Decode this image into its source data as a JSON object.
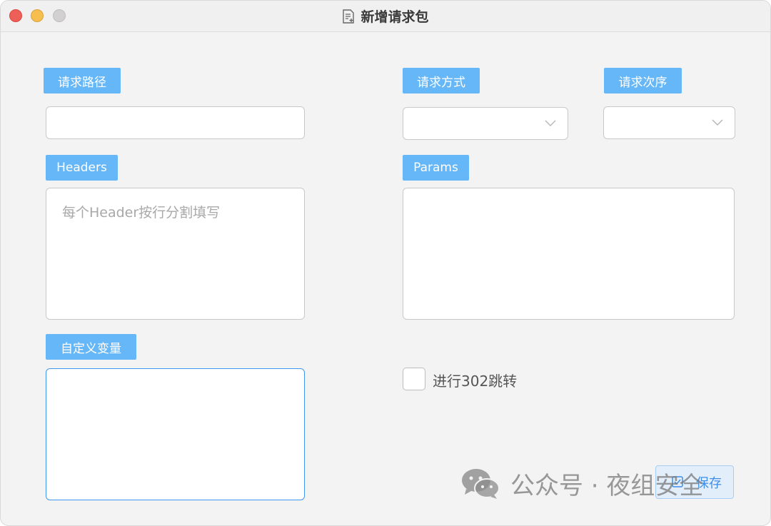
{
  "window": {
    "title": "新增请求包"
  },
  "fields": {
    "path_label": "请求路径",
    "method_label": "请求方式",
    "order_label": "请求次序",
    "headers_label": "Headers",
    "headers_placeholder": "每个Header按行分割填写",
    "params_label": "Params",
    "vars_label": "自定义变量"
  },
  "redirect": {
    "label": "进行302跳转",
    "checked": false
  },
  "save_button": {
    "label": "保存"
  },
  "watermark": {
    "text": "公众号 · 夜组安全"
  },
  "colors": {
    "label_bg": "#66b7f7",
    "focus_border": "#3e98f0",
    "accent": "#3e8ee8"
  }
}
